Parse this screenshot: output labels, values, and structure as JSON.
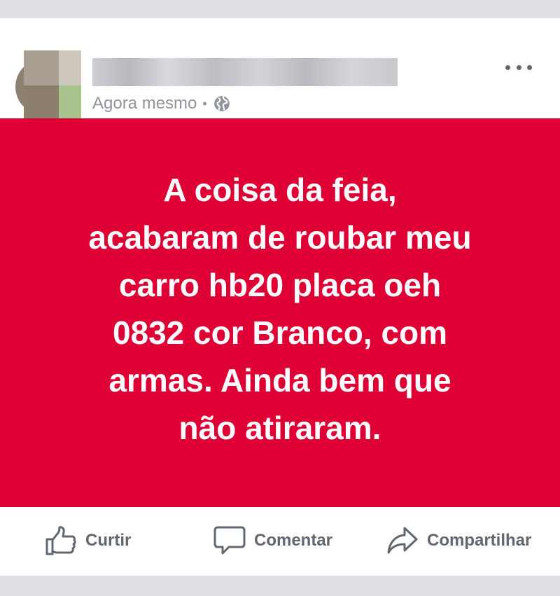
{
  "post": {
    "timestamp": "Agora mesmo",
    "separator": "•",
    "privacy_icon": "globe-icon",
    "menu_icon": "more-options-icon",
    "status_text": "A coisa da feia,\nacabaram de roubar meu\ncarro hb20  placa oeh\n0832 cor Branco, com\narmas. Ainda bem que\nnão atiraram.",
    "background_color": "#de0035",
    "text_color": "#ffffff"
  },
  "actions": {
    "like_label": "Curtir",
    "comment_label": "Comentar",
    "share_label": "Compartilhar"
  }
}
